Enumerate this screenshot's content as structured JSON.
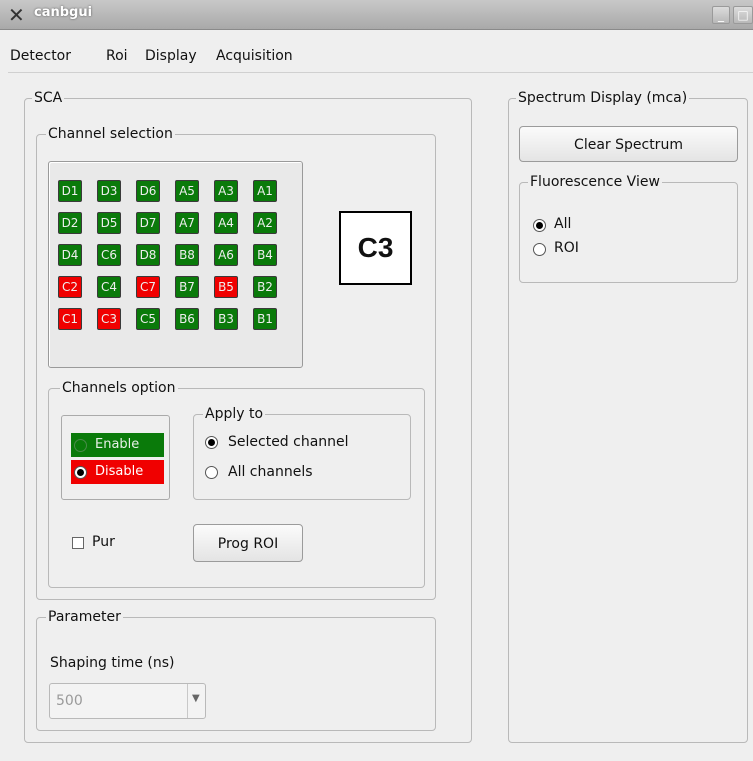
{
  "window": {
    "title": "canbgui",
    "icon": "x-logo-icon",
    "controls": [
      "minimize",
      "maximize"
    ]
  },
  "menu": [
    "Detector",
    "Roi",
    "Display",
    "Acquisition"
  ],
  "sca": {
    "title": "SCA",
    "channel_selection": {
      "title": "Channel selection",
      "rows": [
        [
          {
            "l": "D1",
            "s": "on"
          },
          {
            "l": "D3",
            "s": "on"
          },
          {
            "l": "D6",
            "s": "on"
          },
          {
            "l": "A5",
            "s": "on"
          },
          {
            "l": "A3",
            "s": "on"
          },
          {
            "l": "A1",
            "s": "on"
          }
        ],
        [
          {
            "l": "D2",
            "s": "on"
          },
          {
            "l": "D5",
            "s": "on"
          },
          {
            "l": "D7",
            "s": "on"
          },
          {
            "l": "A7",
            "s": "on"
          },
          {
            "l": "A4",
            "s": "on"
          },
          {
            "l": "A2",
            "s": "on"
          }
        ],
        [
          {
            "l": "D4",
            "s": "on"
          },
          {
            "l": "C6",
            "s": "on"
          },
          {
            "l": "D8",
            "s": "on"
          },
          {
            "l": "B8",
            "s": "on"
          },
          {
            "l": "A6",
            "s": "on"
          },
          {
            "l": "B4",
            "s": "on"
          }
        ],
        [
          {
            "l": "C2",
            "s": "off"
          },
          {
            "l": "C4",
            "s": "on"
          },
          {
            "l": "C7",
            "s": "off"
          },
          {
            "l": "B7",
            "s": "on"
          },
          {
            "l": "B5",
            "s": "off"
          },
          {
            "l": "B2",
            "s": "on"
          }
        ],
        [
          {
            "l": "C1",
            "s": "off"
          },
          {
            "l": "C3",
            "s": "off"
          },
          {
            "l": "C5",
            "s": "on"
          },
          {
            "l": "B6",
            "s": "on"
          },
          {
            "l": "B3",
            "s": "on"
          },
          {
            "l": "B1",
            "s": "on"
          }
        ]
      ],
      "selected": "C3",
      "colors": {
        "on": "#0a7a0a",
        "off": "#f00000"
      }
    },
    "channels_option": {
      "title": "Channels option",
      "enable_label": "Enable",
      "disable_label": "Disable",
      "state": "Disable",
      "apply_to": {
        "title": "Apply to",
        "options": [
          "Selected channel",
          "All channels"
        ],
        "selected": "Selected channel"
      },
      "pur_label": "Pur",
      "pur_checked": false,
      "prog_roi_label": "Prog ROI"
    },
    "parameter": {
      "title": "Parameter",
      "shaping_label": "Shaping time (ns)",
      "shaping_value": "500"
    }
  },
  "spectrum": {
    "title": "Spectrum Display (mca)",
    "clear_label": "Clear Spectrum",
    "fluorescence": {
      "title": "Fluorescence View",
      "options": [
        "All",
        "ROI"
      ],
      "selected": "All"
    }
  }
}
